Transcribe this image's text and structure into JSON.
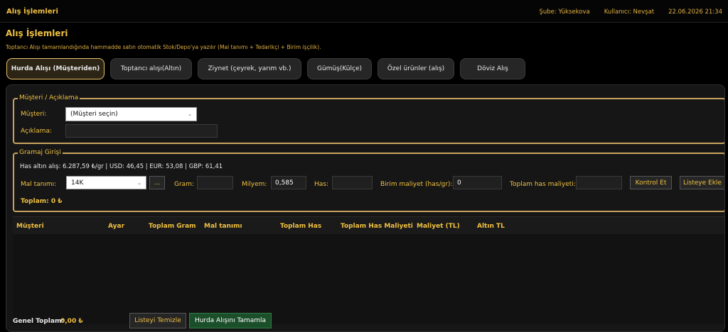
{
  "window": {
    "title": "Alış İşlemleri"
  },
  "header": {
    "branch": "Şube: Yüksekova",
    "user": "Kullanıcı: Nevşat",
    "datetime": "22.06.2026 21:34"
  },
  "page": {
    "title": "Alış İşlemleri",
    "subtitle": "Toptancı Alışı tamamlandığında hammadde satın otomatik Stok/Depo'ya yazılır (Mal tanımı + Tedarikçi + Birim işçilik)."
  },
  "tabs": [
    {
      "label": "Hurda Alışı (Müşteriden)",
      "active": true
    },
    {
      "label": "Toptancı alışı(Altın)",
      "active": false
    },
    {
      "label": "Ziynet (çeyrek, yarım vb.)",
      "active": false
    },
    {
      "label": "Gümüş(Külçe)",
      "active": false
    },
    {
      "label": "Özel ürünler (alış)",
      "active": false
    },
    {
      "label": "Döviz Alış",
      "active": false
    }
  ],
  "customer_section": {
    "legend": "Müşteri / Açıklama",
    "customer_label": "Müşteri:",
    "customer_value": "(Müşteri seçin)",
    "note_label": "Açıklama:",
    "note_value": ""
  },
  "gram_section": {
    "legend": "Gramaj Girişi",
    "rates": "Has altın alış: 6.287,59 ₺/gr | USD: 46,45 | EUR: 53,08 | GBP: 61,41",
    "mal_label": "Mal tanımı:",
    "mal_value": "14K",
    "more_btn": "...",
    "gram_label": "Gram:",
    "gram_value": "",
    "milyem_label": "Milyem:",
    "milyem_value": "0,585",
    "has_label": "Has:",
    "has_value": "",
    "unit_cost_label": "Birim maliyet (has/gr):",
    "unit_cost_value": "0",
    "total_has_cost_label": "Toplam has maliyeti:",
    "total_has_cost_value": "",
    "check_btn": "Kontrol Et",
    "add_btn": "Listeye Ekle",
    "total_label": "Toplam: 0 ₺"
  },
  "table": {
    "columns": [
      "Müşteri",
      "Ayar",
      "Toplam Gram",
      "Mal tanımı",
      "Toplam Has",
      "Toplam Has Maliyeti",
      "Maliyet (TL)",
      "Altın TL"
    ],
    "rows": []
  },
  "footer": {
    "grand_total_label": "Genel Toplam:",
    "grand_total_value": "0,00 ₺",
    "clear_btn": "Listeyi Temizle",
    "complete_btn": "Hurda Alışını Tamamla"
  },
  "colors": {
    "accent": "#f0c040",
    "border_gold": "#c8a460",
    "complete_green": "#1b4f2a"
  }
}
